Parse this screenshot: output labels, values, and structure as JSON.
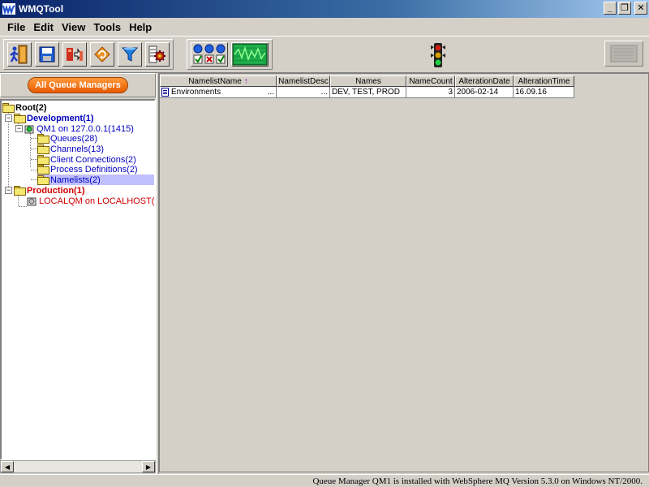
{
  "window": {
    "title": "WMQTool",
    "minimize": "_",
    "restore": "❐",
    "close": "✕"
  },
  "menu": [
    {
      "label": "File"
    },
    {
      "label": "Edit"
    },
    {
      "label": "View"
    },
    {
      "label": "Tools"
    },
    {
      "label": "Help"
    }
  ],
  "toolbar": {
    "buttons": [
      "exit-icon",
      "save-icon",
      "connect-icon",
      "refresh-icon",
      "filter-icon",
      "settings-icon",
      "status-check-icon",
      "monitor-icon"
    ],
    "traffic_light": "green"
  },
  "left": {
    "header_button": "All Queue Managers",
    "tree": {
      "root": "Root(2)",
      "development": "Development(1)",
      "qm1": "QM1  on 127.0.0.1(1415)",
      "queues": "Queues(28)",
      "channels": "Channels(13)",
      "client_connections": "Client Connections(2)",
      "process_definitions": "Process Definitions(2)",
      "namelists": "Namelists(2)",
      "production": "Production(1)",
      "localqm": "LOCALQM on LOCALHOST("
    }
  },
  "grid": {
    "columns": [
      "NamelistName",
      "NamelistDesc",
      "Names",
      "NameCount",
      "AlterationDate",
      "AlterationTime"
    ],
    "sort_indicator": "↑",
    "rows": [
      {
        "name": "Environments",
        "name_more": "...",
        "desc": "",
        "desc_more": "...",
        "names": "DEV, TEST, PROD",
        "count": "3",
        "date": "2006-02-14",
        "time": "16.09.16"
      }
    ]
  },
  "status": "Queue Manager QM1  is installed with WebSphere MQ Version 5.3.0 on Windows NT/2000.",
  "colors": {
    "titlebar": "#0a246a",
    "accent_orange": "#ff9a3c",
    "dev_blue": "#0000c0",
    "prod_red": "#d00000"
  }
}
